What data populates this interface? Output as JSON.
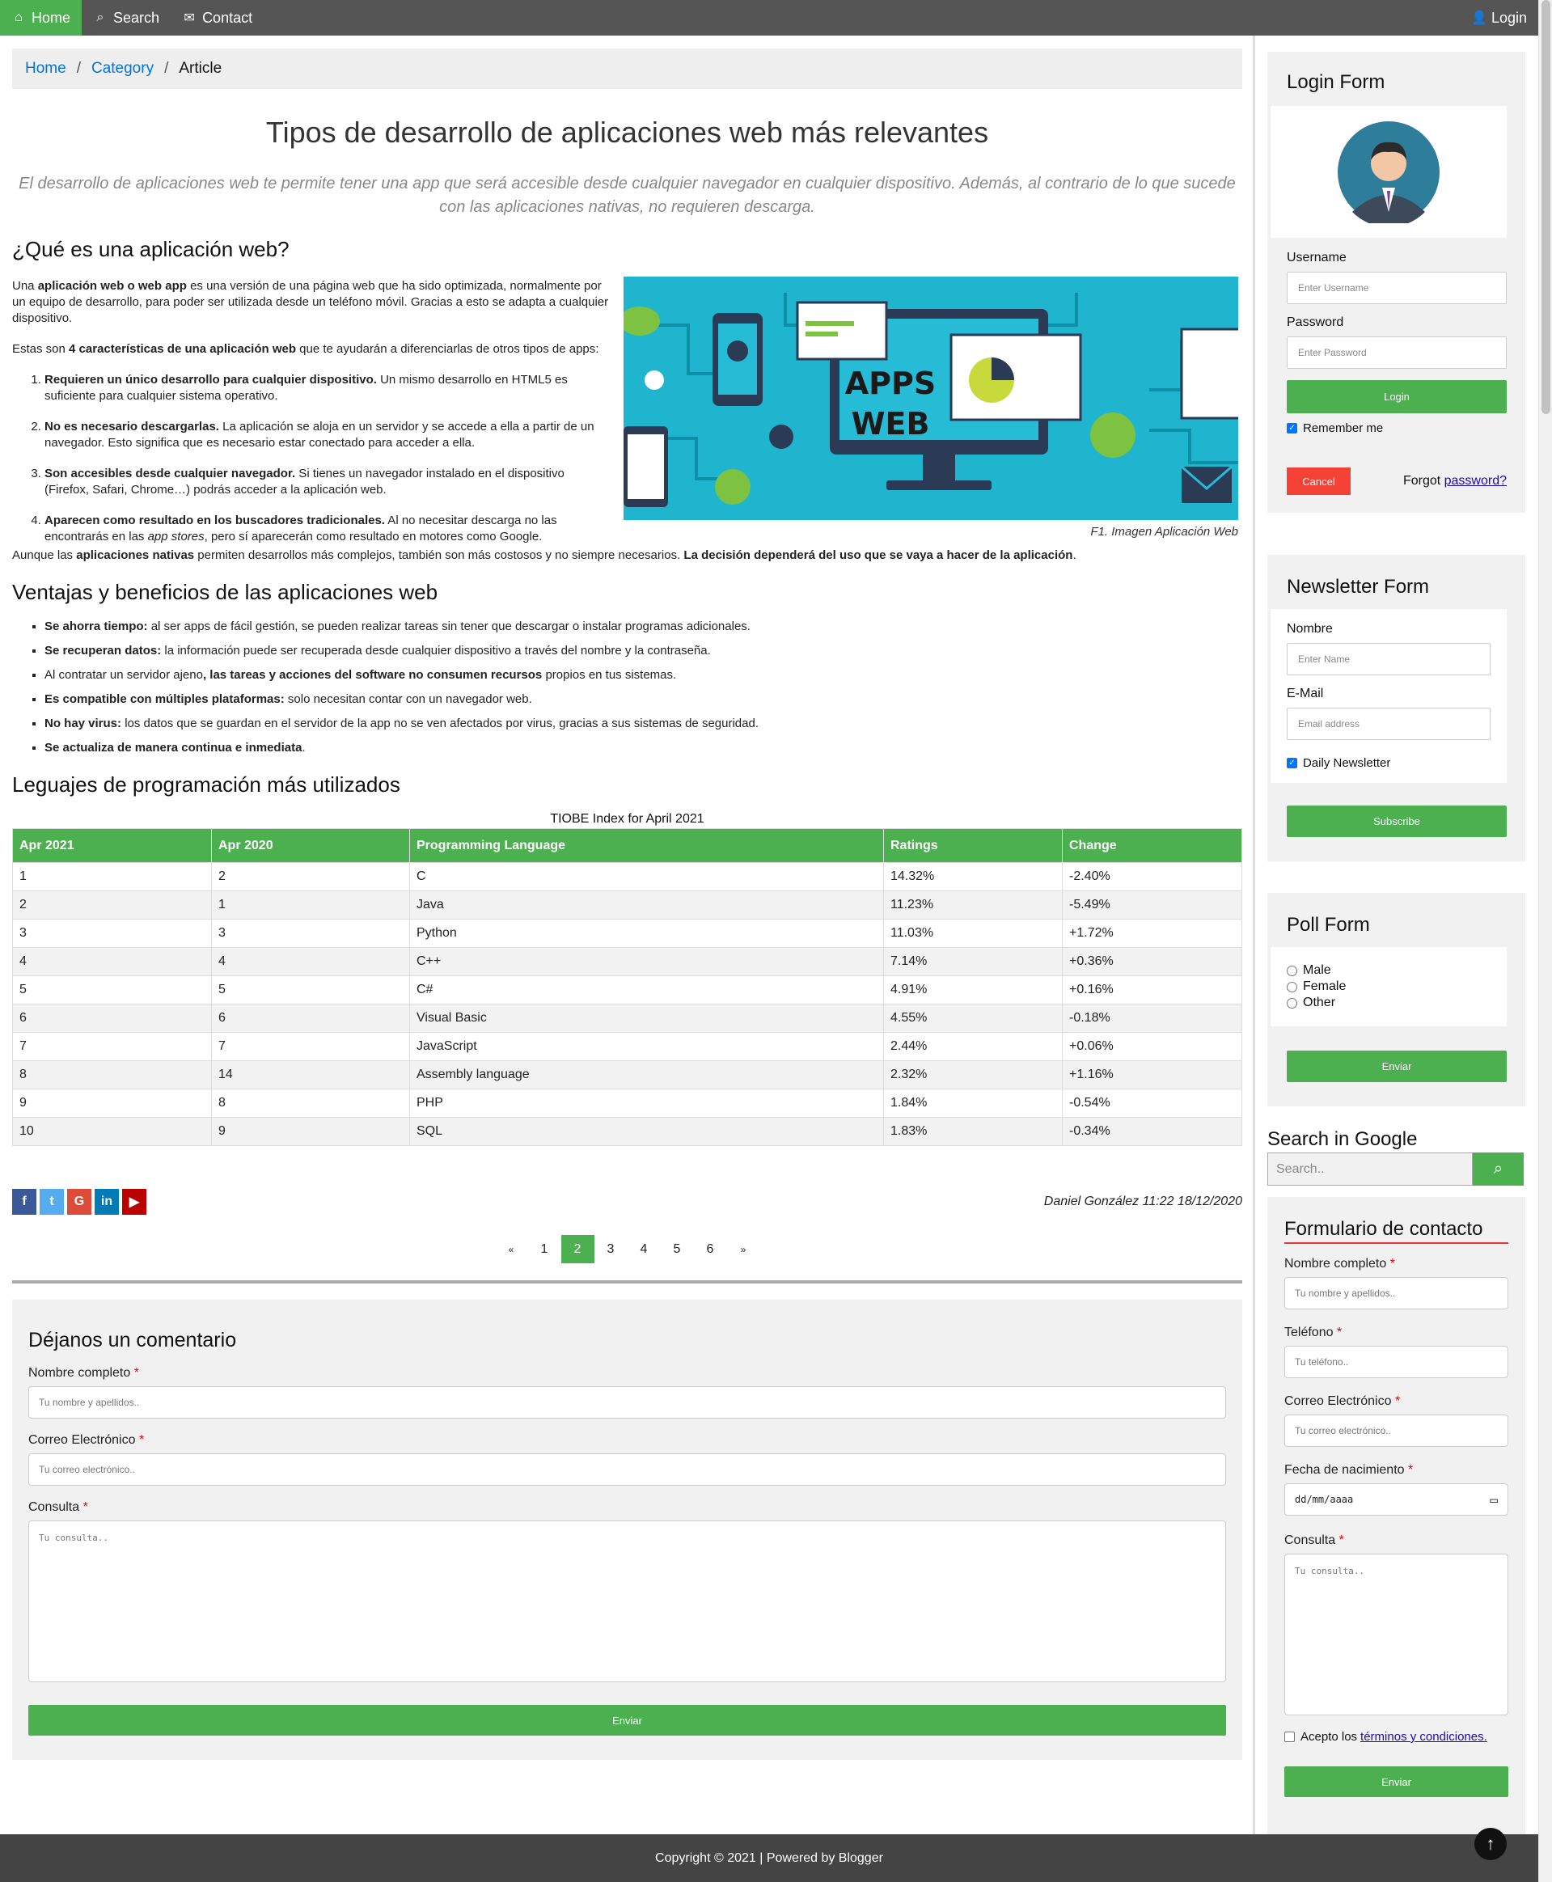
{
  "nav": {
    "home": "Home",
    "search": "Search",
    "contact": "Contact",
    "login": "Login"
  },
  "breadcrumb": {
    "home": "Home",
    "category": "Category",
    "current": "Article",
    "sep": "/"
  },
  "article": {
    "title": "Tipos de desarrollo de aplicaciones web más relevantes",
    "lead": "El desarrollo de aplicaciones web te permite tener una app que será accesible desde cualquier navegador en cualquier dispositivo. Además, al contrario de lo que sucede con las aplicaciones nativas, no requieren descarga.",
    "h_what": "¿Qué es una aplicación web?",
    "p1_a": "Una ",
    "p1_b": "aplicación web o web app",
    "p1_c": " es una versión de una página web que ha sido optimizada, normalmente por un equipo de desarrollo, para poder ser utilizada desde un teléfono móvil. Gracias a esto se adapta a cualquier dispositivo.",
    "p2_a": "Estas son ",
    "p2_b": "4 características de una aplicación web",
    "p2_c": " que te ayudarán a diferenciarlas de otros tipos de apps:",
    "features": [
      {
        "bold": "Requieren un único desarrollo para cualquier dispositivo.",
        "text": " Un mismo desarrollo en HTML5 es suficiente para cualquier sistema operativo."
      },
      {
        "bold": "No es necesario descargarlas.",
        "text": " La aplicación se aloja en un servidor y se accede a ella a partir de un navegador. Esto significa que es necesario estar conectado para acceder a ella."
      },
      {
        "bold": "Son accesibles desde cualquier navegador.",
        "text": " Si tienes un navegador instalado en el dispositivo (Firefox, Safari, Chrome…) podrás acceder a la aplicación web."
      },
      {
        "bold": "Aparecen como resultado en los buscadores tradicionales.",
        "text": " Al no necesitar descarga no las encontrarás en las ",
        "italic": "app stores",
        "text2": ", pero sí aparecerán como resultado en motores como Google."
      }
    ],
    "figure_text_1": "APPS",
    "figure_text_2": "WEB",
    "figure_caption": "F1. Imagen Aplicación Web",
    "p3_a": "Aunque las ",
    "p3_b": "aplicaciones nativas",
    "p3_c": " permiten desarrollos más complejos, también son más costosos y no siempre necesarios. ",
    "p3_d": "La decisión dependerá del uso que se vaya a hacer de la aplicación",
    "p3_e": ".",
    "h_adv": "Ventajas y beneficios de las aplicaciones web",
    "adv1_b": "Se ahorra tiempo:",
    "adv1_t": " al ser apps de fácil gestión, se pueden realizar tareas sin tener que descargar o instalar programas adicionales.",
    "adv2_b": "Se recuperan datos:",
    "adv2_t": " la información puede ser recuperada desde cualquier dispositivo a través del nombre y la contraseña.",
    "adv3_a": "Al contratar un servidor ajeno",
    "adv3_b": ", las tareas y acciones del software no consumen recursos",
    "adv3_c": " propios en tus sistemas.",
    "adv4_b": "Es compatible con múltiples plataformas:",
    "adv4_t": " solo necesitan contar con un navegador web.",
    "adv5_b": "No hay virus:",
    "adv5_t": " los datos que se guardan en el servidor de la app no se ven afectados por virus, gracias a sus sistemas de seguridad.",
    "adv6_b": "Se actualiza de manera continua e inmediata",
    "adv6_t": ".",
    "h_lang": "Leguajes de programación más utilizados",
    "author": "Daniel González 11:22 18/12/2020"
  },
  "table": {
    "caption": "TIOBE Index for April 2021",
    "headers": [
      "Apr 2021",
      "Apr 2020",
      "Programming Language",
      "Ratings",
      "Change"
    ],
    "rows": [
      [
        "1",
        "2",
        "C",
        "14.32%",
        "-2.40%"
      ],
      [
        "2",
        "1",
        "Java",
        "11.23%",
        "-5.49%"
      ],
      [
        "3",
        "3",
        "Python",
        "11.03%",
        "+1.72%"
      ],
      [
        "4",
        "4",
        "C++",
        "7.14%",
        "+0.36%"
      ],
      [
        "5",
        "5",
        "C#",
        "4.91%",
        "+0.16%"
      ],
      [
        "6",
        "6",
        "Visual Basic",
        "4.55%",
        "-0.18%"
      ],
      [
        "7",
        "7",
        "JavaScript",
        "2.44%",
        "+0.06%"
      ],
      [
        "8",
        "14",
        "Assembly language",
        "2.32%",
        "+1.16%"
      ],
      [
        "9",
        "8",
        "PHP",
        "1.84%",
        "-0.54%"
      ],
      [
        "10",
        "9",
        "SQL",
        "1.83%",
        "-0.34%"
      ]
    ]
  },
  "social": {
    "facebook": "f",
    "twitter": "t",
    "google": "G",
    "linkedin": "in",
    "youtube": "▶",
    "colors": {
      "facebook": "#3b5998",
      "twitter": "#55acee",
      "google": "#dd4b39",
      "linkedin": "#007bb5",
      "youtube": "#bb0000"
    }
  },
  "pagination": {
    "prev": "«",
    "pages": [
      "1",
      "2",
      "3",
      "4",
      "5",
      "6"
    ],
    "active": "2",
    "next": "»"
  },
  "comment": {
    "title": "Déjanos un comentario",
    "name_label": "Nombre completo",
    "name_ph": "Tu nombre y apellidos..",
    "email_label": "Correo Electrónico",
    "email_ph": "Tu correo electrónico..",
    "query_label": "Consulta",
    "query_ph": "Tu consulta..",
    "submit": "Enviar",
    "required": "*"
  },
  "login": {
    "title": "Login Form",
    "username_label": "Username",
    "username_ph": "Enter Username",
    "password_label": "Password",
    "password_ph": "Enter Password",
    "submit": "Login",
    "remember": "Remember me",
    "cancel": "Cancel",
    "forgot": "Forgot ",
    "forgot_link": "password?"
  },
  "newsletter": {
    "title": "Newsletter Form",
    "name_label": "Nombre",
    "name_ph": "Enter Name",
    "email_label": "E-Mail",
    "email_ph": "Email address",
    "daily": "Daily Newsletter",
    "submit": "Subscribe"
  },
  "poll": {
    "title": "Poll Form",
    "options": [
      "Male",
      "Female",
      "Other"
    ],
    "submit": "Enviar"
  },
  "google": {
    "title": "Search in Google",
    "placeholder": "Search.."
  },
  "contact": {
    "title": "Formulario de contacto",
    "name_label": "Nombre completo",
    "name_ph": "Tu nombre y apellidos..",
    "phone_label": "Teléfono",
    "phone_ph": "Tu teléfono..",
    "email_label": "Correo Electrónico",
    "email_ph": "Tu correo electrónico..",
    "birth_label": "Fecha de nacimiento",
    "birth_ph": "dd/mm/aaaa",
    "query_label": "Consulta",
    "query_ph": "Tu consulta..",
    "terms_a": "Acepto los ",
    "terms_link": "términos y condiciones.",
    "submit": "Enviar",
    "required": "*"
  },
  "footer": {
    "text": "Copyright © 2021 | Powered by Blogger",
    "top": "↑"
  },
  "colors": {
    "accent": "#4caf50",
    "nav": "#555555",
    "link": "#0275d8",
    "cancel": "#f44336",
    "footer": "#444444"
  }
}
